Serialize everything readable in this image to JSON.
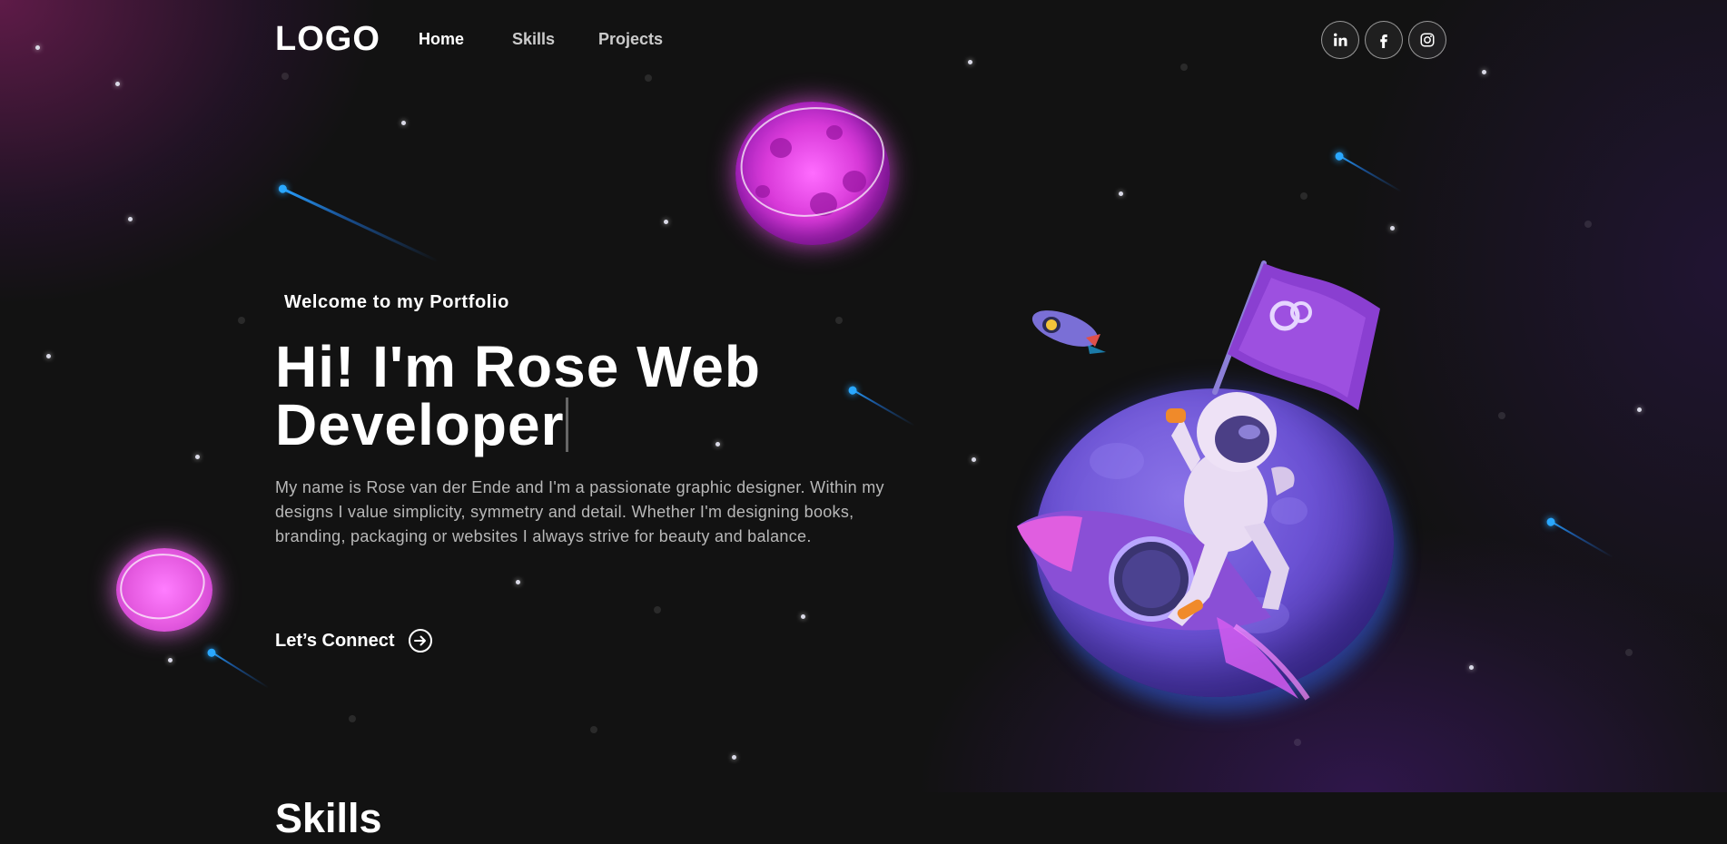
{
  "nav": {
    "logo": "LOGO",
    "links": [
      {
        "label": "Home",
        "active": true
      },
      {
        "label": "Skills",
        "active": false
      },
      {
        "label": "Projects",
        "active": false
      }
    ],
    "social": [
      {
        "label": "in",
        "icon": "linkedin-icon"
      },
      {
        "label": "f",
        "icon": "facebook-icon"
      },
      {
        "label": "ig",
        "icon": "instagram-icon"
      }
    ]
  },
  "hero": {
    "tagline": "Welcome to my Portfolio",
    "headline_line1": "Hi! I'm Rose Web",
    "headline_line2": "Developer",
    "intro": "My name is Rose van der Ende and I'm a passionate graphic designer. Within my designs I value simplicity, symmetry and detail. Whether I'm designing books, branding, packaging or websites I always strive for beauty and balance.",
    "cta": "Let’s Connect",
    "cta_icon": "arrow-right-circle-icon"
  },
  "sections": {
    "skills_title": "Skills"
  },
  "theme": {
    "background": "#121212",
    "accent_purple": "#d93ad9",
    "streak_blue": "#2aa8ff",
    "globe_purple": "#6b52d4"
  }
}
